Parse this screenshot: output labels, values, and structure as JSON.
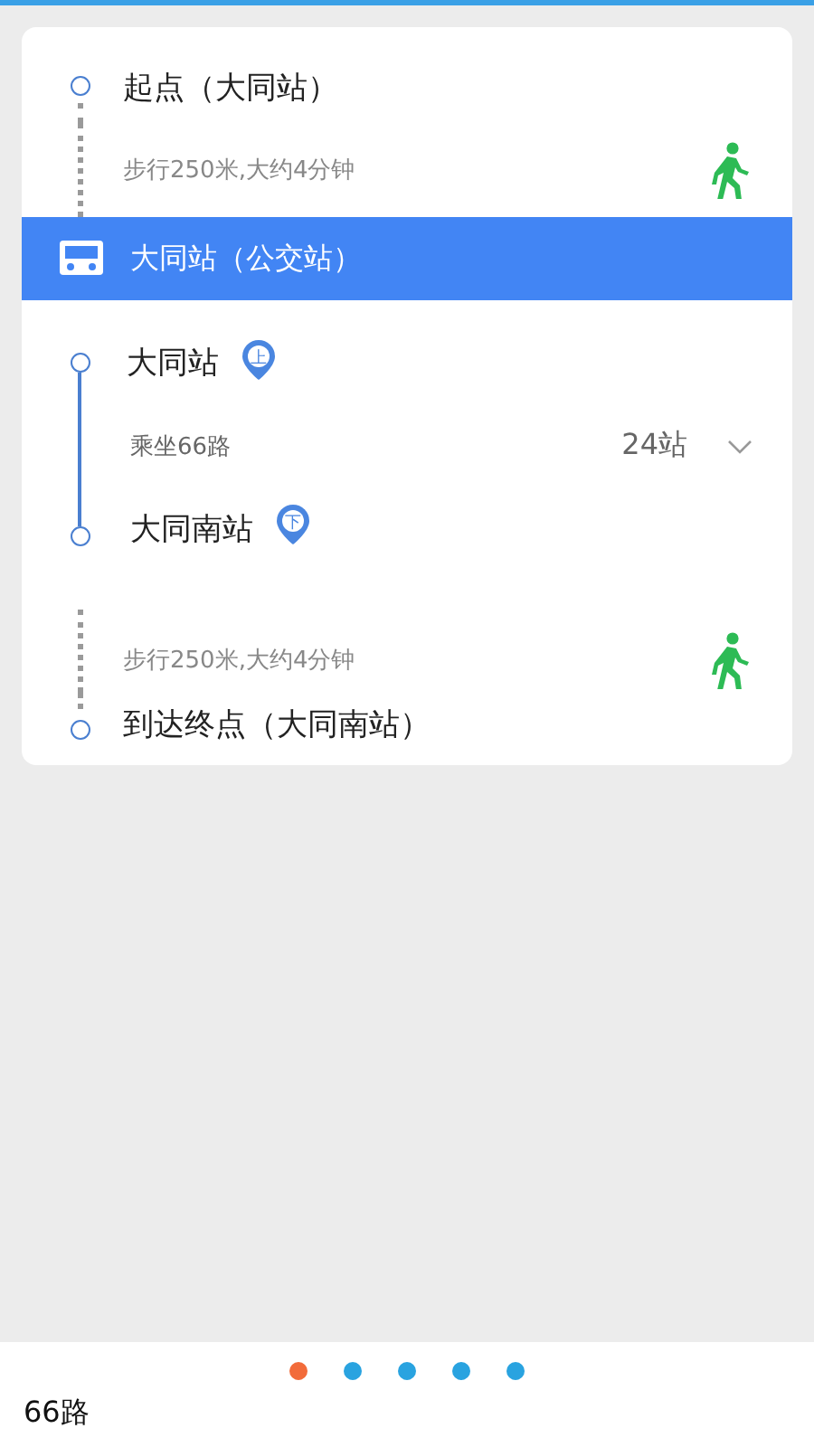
{
  "route": [
    {
      "kind": "start",
      "label": "起点（大同站）"
    },
    {
      "kind": "walk",
      "text": "步行250米,大约4分钟"
    },
    {
      "kind": "bus_header",
      "label": "大同站（公交站）"
    },
    {
      "kind": "board",
      "label": "大同站",
      "badge": "上"
    },
    {
      "kind": "ride",
      "text": "乘坐66路",
      "stops": "24站",
      "expanded": false
    },
    {
      "kind": "alight",
      "label": "大同南站",
      "badge": "下"
    },
    {
      "kind": "walk",
      "text": "步行250米,大约4分钟"
    },
    {
      "kind": "end",
      "label": "到达终点（大同南站）"
    }
  ],
  "pager": [
    {
      "selected": true
    },
    {
      "selected": false
    },
    {
      "selected": false
    },
    {
      "selected": false
    },
    {
      "selected": false
    }
  ],
  "footer": {
    "title": "66路"
  }
}
